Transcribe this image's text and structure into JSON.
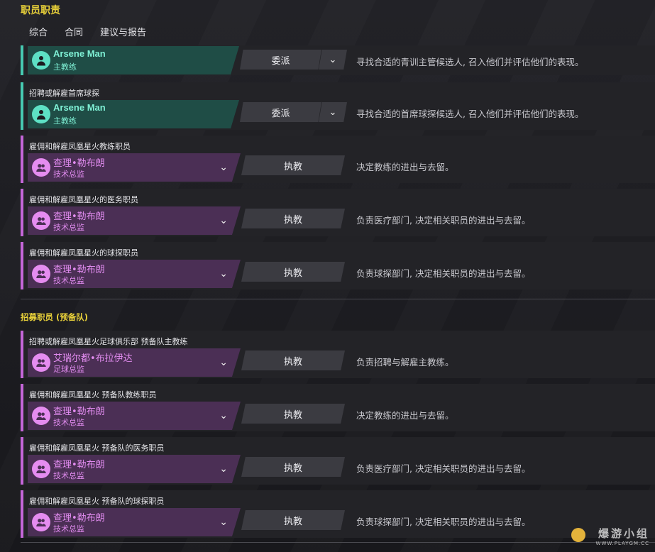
{
  "page": {
    "title": "职员职责"
  },
  "tabs": [
    {
      "label": "综合",
      "active": true
    },
    {
      "label": "合同",
      "active": false
    },
    {
      "label": "建议与报告",
      "active": false
    }
  ],
  "rows": [
    {
      "label": "",
      "name": "Arsene Man",
      "role": "主教练",
      "action": "委派",
      "desc": "寻找合适的青训主管候选人, 召入他们并评估他们的表现。",
      "color": "green"
    },
    {
      "label": "招聘或解雇首席球探",
      "name": "Arsene Man",
      "role": "主教练",
      "action": "委派",
      "desc": "寻找合适的首席球探候选人, 召入他们并评估他们的表现。",
      "color": "green"
    },
    {
      "label": "雇佣和解雇凤凰星火教练职员",
      "name": "查理•勒布朗",
      "role": "技术总监",
      "action": "执教",
      "desc": "决定教练的进出与去留。",
      "color": "purple"
    },
    {
      "label": "雇佣和解雇凤凰星火的医务职员",
      "name": "查理•勒布朗",
      "role": "技术总监",
      "action": "执教",
      "desc": "负责医疗部门, 决定相关职员的进出与去留。",
      "color": "purple"
    },
    {
      "label": "雇佣和解雇凤凰星火的球探职员",
      "name": "查理•勒布朗",
      "role": "技术总监",
      "action": "执教",
      "desc": "负责球探部门, 决定相关职员的进出与去留。",
      "color": "purple"
    }
  ],
  "section2": {
    "title": "招募职员 (预备队)"
  },
  "rows2": [
    {
      "label": "招聘或解雇凤凰星火足球俱乐部 预备队主教练",
      "name": "艾瑞尔都•布拉伊达",
      "role": "足球总监",
      "action": "执教",
      "desc": "负责招聘与解雇主教练。",
      "color": "purple"
    },
    {
      "label": "雇佣和解雇凤凰星火 预备队教练职员",
      "name": "查理•勒布朗",
      "role": "技术总监",
      "action": "执教",
      "desc": "决定教练的进出与去留。",
      "color": "purple"
    },
    {
      "label": "雇佣和解雇凤凰星火 预备队的医务职员",
      "name": "查理•勒布朗",
      "role": "技术总监",
      "action": "执教",
      "desc": "负责医疗部门, 决定相关职员的进出与去留。",
      "color": "purple"
    },
    {
      "label": "雇佣和解雇凤凰星火 预备队的球探职员",
      "name": "查理•勒布朗",
      "role": "技术总监",
      "action": "执教",
      "desc": "负责球探部门, 决定相关职员的进出与去留。",
      "color": "purple"
    }
  ],
  "watermark": {
    "top": "爆游小组",
    "bottom": "WWW.PLAYGM.CC"
  },
  "colors": {
    "accent": "#e9d13a",
    "green": "#46c9b1",
    "purple": "#c466d8"
  }
}
